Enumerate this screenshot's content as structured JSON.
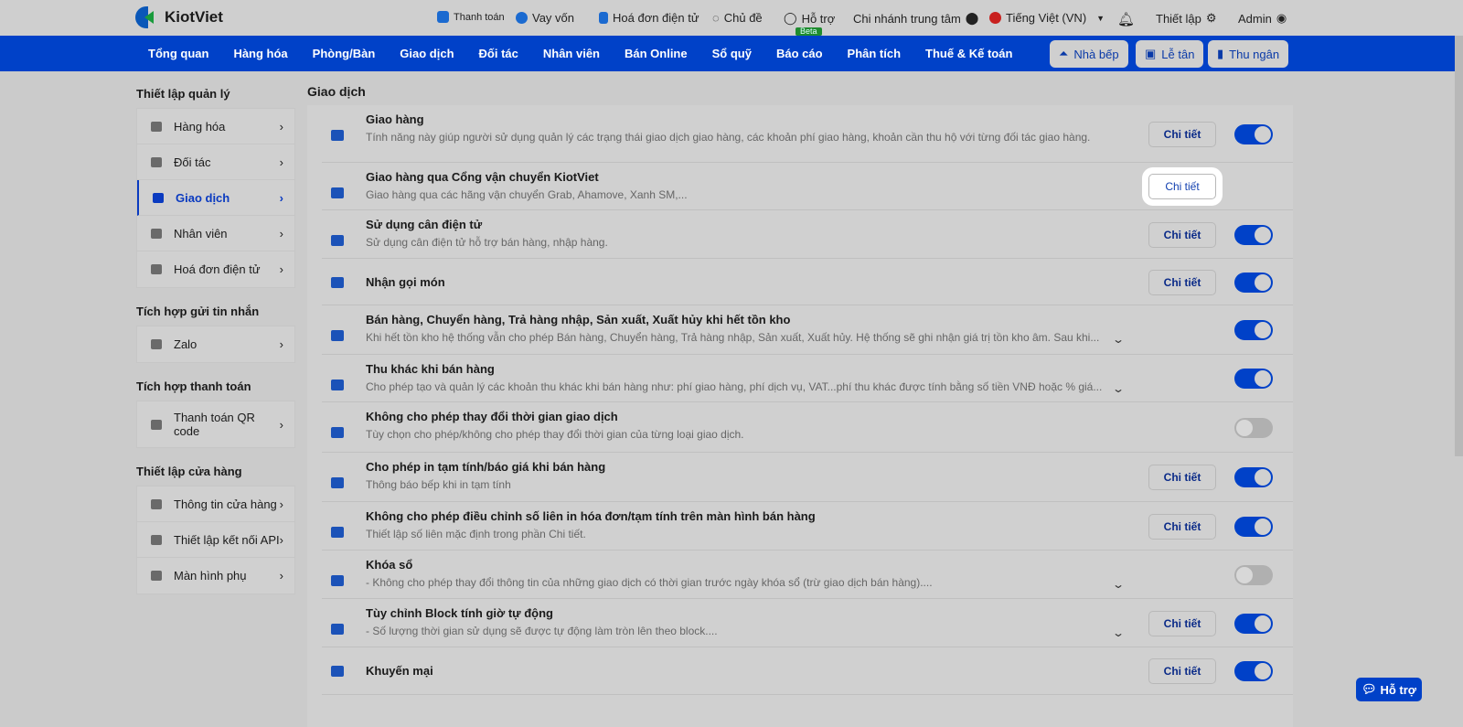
{
  "app": {
    "name": "KiotViet"
  },
  "top": {
    "payment": "Thanh toán",
    "loan": "Vay vốn",
    "einvoice": "Hoá đơn điện tử",
    "theme": "Chủ đề",
    "support": "Hỗ trợ",
    "beta": "Beta",
    "branch": "Chi nhánh trung tâm",
    "language": "Tiếng Việt (VN)",
    "settings": "Thiết lập",
    "user": "Admin"
  },
  "nav": {
    "items": [
      "Tổng quan",
      "Hàng hóa",
      "Phòng/Bàn",
      "Giao dịch",
      "Đối tác",
      "Nhân viên",
      "Bán Online",
      "Sổ quỹ",
      "Báo cáo",
      "Phân tích",
      "Thuế & Kế toán"
    ],
    "kitchen": "Nhà bếp",
    "reception": "Lễ tân",
    "cashier": "Thu ngân"
  },
  "sidebar": {
    "groups": [
      {
        "title": "Thiết lập quản lý",
        "items": [
          "Hàng hóa",
          "Đối tác",
          "Giao dịch",
          "Nhân viên",
          "Hoá đơn điện tử"
        ],
        "active": 2
      },
      {
        "title": "Tích hợp gửi tin nhắn",
        "items": [
          "Zalo"
        ]
      },
      {
        "title": "Tích hợp thanh toán",
        "items": [
          "Thanh toán QR code"
        ]
      },
      {
        "title": "Thiết lập cửa hàng",
        "items": [
          "Thông tin cửa hàng",
          "Thiết lập kết nối API",
          "Màn hình phụ"
        ]
      }
    ]
  },
  "content": {
    "title": "Giao dịch",
    "detail_label": "Chi tiết",
    "rows": [
      {
        "title": "Giao hàng",
        "desc": "Tính năng này giúp người sử dụng quản lý các trạng thái giao dịch giao hàng, các khoản phí giao hàng, khoản cần thu hộ với từng đối tác giao hàng.",
        "button": true,
        "toggle": "on",
        "icon": "truck-icon"
      },
      {
        "title": "Giao hàng qua Cổng vận chuyển KiotViet",
        "desc": "Giao hàng qua các hãng vận chuyển Grab, Ahamove, Xanh SM,...",
        "button": true,
        "highlight": true,
        "icon": "truck-icon"
      },
      {
        "title": "Sử dụng cân điện tử",
        "desc": "Sử dụng cân điện tử hỗ trợ bán hàng, nhập hàng.",
        "button": true,
        "toggle": "on",
        "icon": "scale-icon"
      },
      {
        "title": "Nhận gọi món",
        "desc": "",
        "button": true,
        "toggle": "on",
        "icon": "basket-icon"
      },
      {
        "title": "Bán hàng, Chuyển hàng, Trả hàng nhập, Sản xuất, Xuất hủy khi hết tồn kho",
        "desc": "Khi hết tồn kho hệ thống vẫn cho phép Bán hàng, Chuyển hàng, Trả hàng nhập, Sản xuất, Xuất hủy. Hệ thống sẽ ghi nhận giá trị tồn kho âm. Sau khi...",
        "expand": true,
        "toggle": "on",
        "icon": "inventory-icon"
      },
      {
        "title": "Thu khác khi bán hàng",
        "desc": "Cho phép tạo và quản lý các khoản thu khác khi bán hàng như: phí giao hàng, phí dịch vụ, VAT...phí thu khác được tính bằng số tiền VNĐ hoặc % giá...",
        "expand": true,
        "toggle": "on",
        "icon": "cart-plus-icon"
      },
      {
        "title": "Không cho phép thay đổi thời gian giao dịch",
        "desc": "Tùy chọn cho phép/không cho phép thay đổi thời gian của từng loại giao dịch.",
        "toggle": "off",
        "icon": "clock-icon"
      },
      {
        "title": "Cho phép in tạm tính/báo giá khi bán hàng",
        "desc": "Thông báo bếp khi in tạm tính",
        "button": true,
        "toggle": "on",
        "icon": "printer-icon"
      },
      {
        "title": "Không cho phép điều chỉnh số liên in hóa đơn/tạm tính trên màn hình bán hàng",
        "desc": "Thiết lập số liên mặc định trong phần Chi tiết.",
        "button": true,
        "toggle": "on",
        "icon": "copy-icon"
      },
      {
        "title": "Khóa sổ",
        "desc": "- Không cho phép thay đổi thông tin của những giao dịch có thời gian trước ngày khóa sổ (trừ giao dịch bán hàng)....",
        "expand": true,
        "toggle": "off",
        "icon": "lock-icon"
      },
      {
        "title": "Tùy chỉnh Block tính giờ tự động",
        "desc": "- Số lượng thời gian sử dụng sẽ được tự động làm tròn lên theo block....",
        "expand": true,
        "button": true,
        "toggle": "on",
        "icon": "clock-gear-icon"
      },
      {
        "title": "Khuyến mại",
        "desc": "",
        "button": true,
        "toggle": "on",
        "icon": "gift-icon"
      }
    ]
  },
  "help": {
    "label": "Hỗ trợ"
  }
}
